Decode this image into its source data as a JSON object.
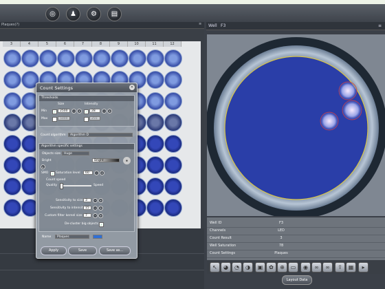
{
  "toolbar": {
    "buttons": [
      {
        "icon": "globe-icon",
        "glyph": "◎"
      },
      {
        "icon": "users-icon",
        "glyph": "♟"
      },
      {
        "icon": "gear-icon",
        "glyph": "⚙"
      },
      {
        "icon": "book-icon",
        "glyph": "▤"
      }
    ]
  },
  "plate_panel": {
    "subtitle": "Plaques(?)",
    "columns": [
      "3",
      "4",
      "5",
      "6",
      "7",
      "8",
      "9",
      "10",
      "11",
      "12"
    ]
  },
  "well_panel": {
    "label": "Well",
    "well_id": "F3"
  },
  "info_table": [
    {
      "key": "Well ID",
      "value": "F3"
    },
    {
      "key": "Channels",
      "value": "LED"
    },
    {
      "key": "Count Result",
      "value": "3"
    },
    {
      "key": "Well Saturation",
      "value": "78"
    },
    {
      "key": "Count Settings",
      "value": "Plaques"
    }
  ],
  "layout_button": "Layout Data",
  "dialog": {
    "title": "Count Settings",
    "thresholds": {
      "header": "Thresholds",
      "size_label": "Size",
      "intensity_label": "Intensity",
      "min_label": "Min",
      "max_label": "Max",
      "size_min": "2500",
      "size_max": "5000",
      "int_min": "28",
      "int_max": "255"
    },
    "algorithm": {
      "label": "Count algorithm",
      "value": "Algorithm D"
    },
    "specific": {
      "header": "Algorithm specific settings",
      "objects_size_label": "Objects size",
      "objects_size_value": "Huge",
      "objects_are_label": "Objects are",
      "objects_are_value": "Bright",
      "smo_label": "SMO",
      "saturation_label": "Saturation level",
      "saturation_value": "60",
      "count_speed_label": "Count speed",
      "quality_label": "Quality",
      "speed_label": "Speed",
      "sens_size_label": "Sensitivity to size",
      "sens_size_value": "3",
      "sens_int_label": "Sensitivity to intensity",
      "sens_int_value": "15",
      "filter_label": "Custom filter kernel size",
      "filter_value": "7",
      "decluster_label": "De-cluster big objects"
    },
    "name_label": "Name",
    "name_value": "Plaques",
    "apply": "Apply",
    "save": "Save",
    "save_as": "Save as..."
  }
}
